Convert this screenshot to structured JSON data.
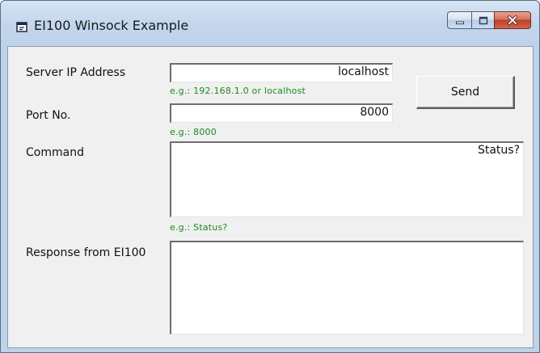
{
  "window": {
    "title": "EI100 Winsock Example",
    "app_icon": "window-app-icon",
    "caption_buttons": {
      "minimize_icon": "minimize-icon",
      "maximize_icon": "maximize-icon",
      "close_icon": "close-icon"
    }
  },
  "form": {
    "server_ip": {
      "label": "Server IP Address",
      "value": "localhost",
      "hint": "e.g.: 192.168.1.0 or localhost"
    },
    "port": {
      "label": "Port No.",
      "value": "8000",
      "hint": "e.g.: 8000"
    },
    "command": {
      "label": "Command",
      "value": "Status?",
      "hint": "e.g.: Status?"
    },
    "response": {
      "label": "Response from EI100",
      "value": ""
    },
    "send_label": "Send"
  },
  "colors": {
    "hint_text": "#1b8a1b",
    "close_button": "#c0402a",
    "client_background": "#f0f0f0"
  }
}
